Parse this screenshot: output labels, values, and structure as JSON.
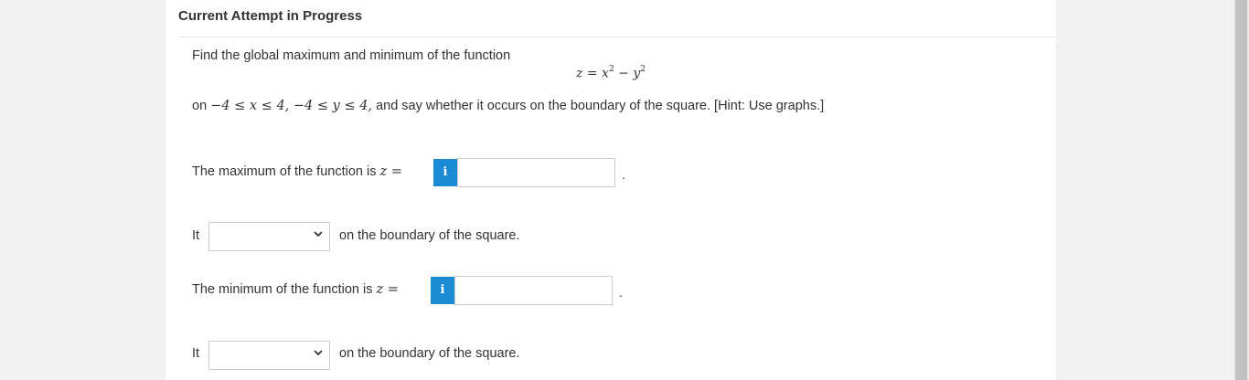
{
  "header": {
    "title": "Current Attempt in Progress"
  },
  "question": {
    "intro": "Find the global maximum and minimum of the function",
    "equation": {
      "lhs": "z",
      "eq": "=",
      "a": "x",
      "op": "−",
      "b": "y",
      "exp": "2"
    },
    "domain_prefix": "on",
    "domain_math": "−4 ≤ x ≤ 4, −4 ≤ y ≤ 4,",
    "domain_suffix": "and say whether it occurs on the boundary of the square. [Hint: Use graphs.]"
  },
  "max_part": {
    "label": "The maximum of the function is",
    "var": "z =",
    "info": "i",
    "value": "",
    "period": "."
  },
  "max_boundary": {
    "prefix": "It",
    "selected": "",
    "suffix": "on the boundary of the square."
  },
  "min_part": {
    "label": "The minimum of the function is",
    "var": "z =",
    "info": "i",
    "value": "",
    "period": "."
  },
  "min_boundary": {
    "prefix": "It",
    "selected": "",
    "suffix": "on the boundary of the square."
  },
  "colors": {
    "info_button": "#1b8bd6",
    "border": "#cccccc"
  }
}
